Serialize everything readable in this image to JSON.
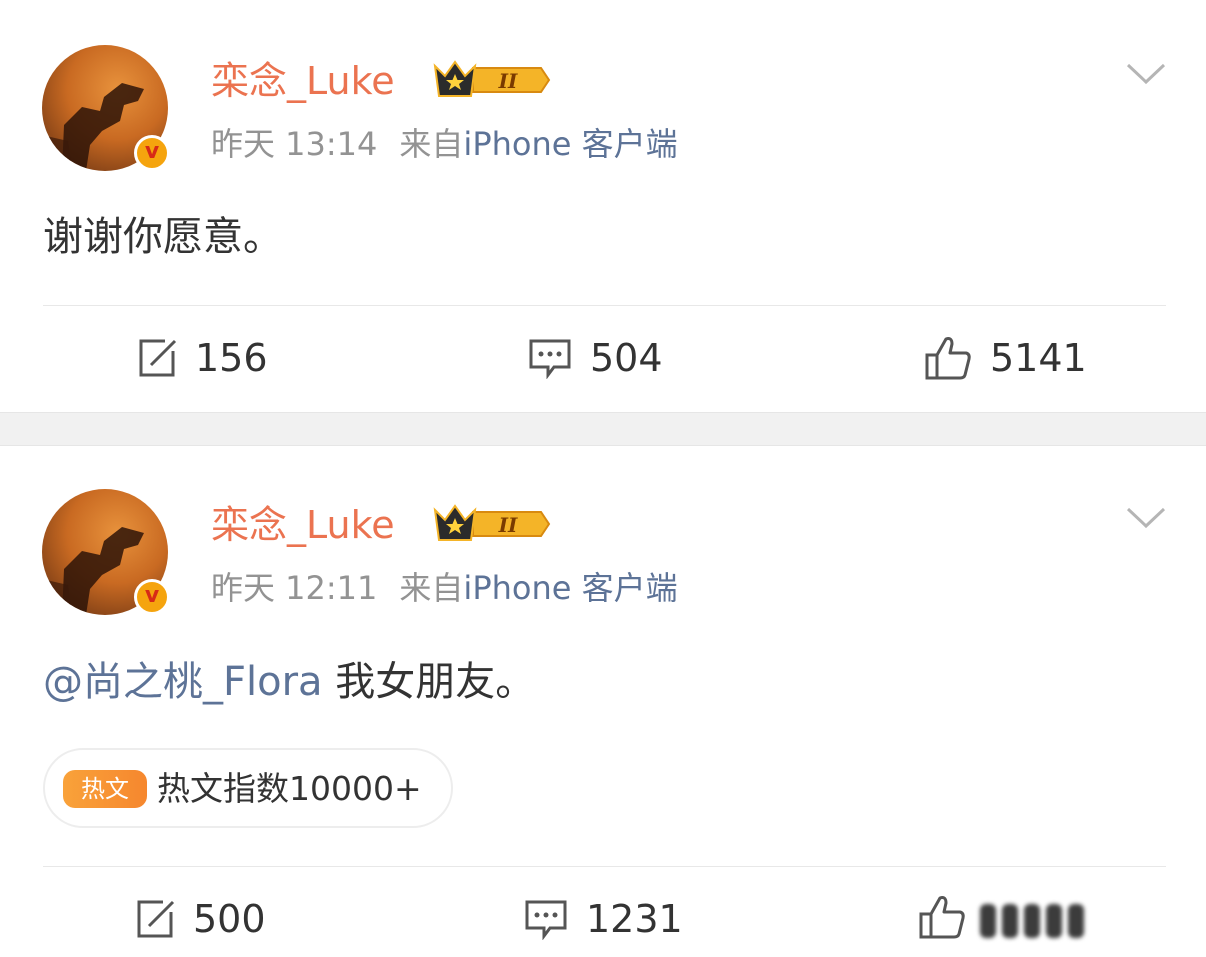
{
  "posts": [
    {
      "username": "栾念_Luke",
      "vip_level": "II",
      "verified": "v",
      "time": "昨天 13:14",
      "source_prefix": "来自",
      "source_client": "iPhone 客户端",
      "content": "谢谢你愿意。",
      "actions": {
        "repost_count": "156",
        "comment_count": "504",
        "like_count": "5141"
      }
    },
    {
      "username": "栾念_Luke",
      "vip_level": "II",
      "verified": "v",
      "time": "昨天 12:11",
      "source_prefix": "来自",
      "source_client": "iPhone 客户端",
      "mention": "@尚之桃_Flora",
      "content": " 我女朋友。",
      "hot": {
        "tag": "热文",
        "index": "热文指数10000+"
      },
      "actions": {
        "repost_count": "500",
        "comment_count": "1231"
      }
    }
  ],
  "colors": {
    "username": "#eb7350",
    "link": "#5d7397",
    "meta": "#939393",
    "text": "#333333",
    "hot_tag": "#f6872e",
    "separator": "#f1f1f1"
  },
  "icons": [
    "repost-icon",
    "comment-icon",
    "like-icon",
    "chevron-down-icon",
    "vip-crown-icon",
    "verified-badge-icon"
  ]
}
